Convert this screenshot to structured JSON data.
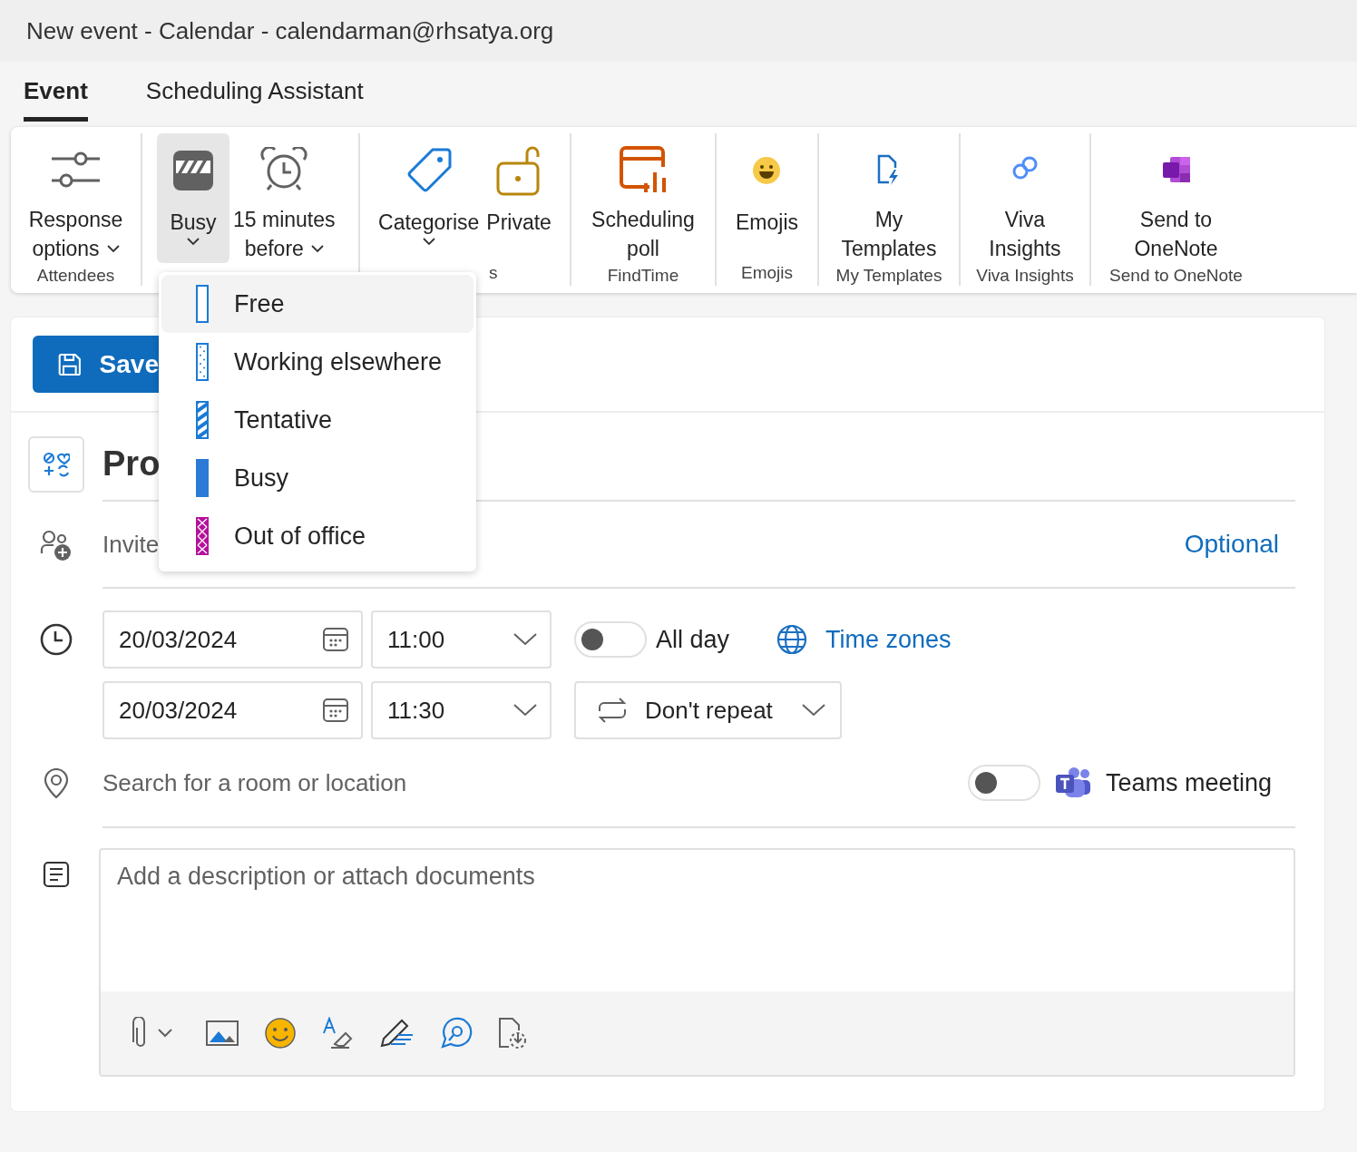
{
  "window": {
    "title": "New event - Calendar - calendarman@rhsatya.org"
  },
  "tabs": [
    {
      "label": "Event",
      "selected": true
    },
    {
      "label": "Scheduling Assistant",
      "selected": false
    }
  ],
  "ribbon": {
    "groups": [
      {
        "label": "Attendees",
        "buttons": [
          {
            "lines": [
              "Response",
              "options"
            ],
            "dropdown": true,
            "selected": false
          }
        ]
      },
      {
        "buttons": [
          {
            "lines": [
              "Busy"
            ],
            "dropdown": true,
            "selected": true
          },
          {
            "lines": [
              "15 minutes",
              "before"
            ],
            "dropdown": true,
            "selected": false
          }
        ]
      },
      {
        "label": "s",
        "buttons": [
          {
            "lines": [
              "Categorise"
            ],
            "dropdown": true,
            "selected": false
          },
          {
            "lines": [
              "Private"
            ],
            "dropdown": false,
            "selected": false
          }
        ]
      },
      {
        "label": "FindTime",
        "buttons": [
          {
            "lines": [
              "Scheduling",
              "poll"
            ],
            "dropdown": false,
            "selected": false
          }
        ]
      },
      {
        "label": "Emojis",
        "buttons": [
          {
            "lines": [
              "Emojis"
            ],
            "dropdown": false,
            "selected": false
          }
        ]
      },
      {
        "label": "My Templates",
        "buttons": [
          {
            "lines": [
              "My",
              "Templates"
            ],
            "dropdown": false,
            "selected": false
          }
        ]
      },
      {
        "label": "Viva Insights",
        "buttons": [
          {
            "lines": [
              "Viva",
              "Insights"
            ],
            "dropdown": false,
            "selected": false
          }
        ]
      },
      {
        "label": "Send to OneNote",
        "buttons": [
          {
            "lines": [
              "Send to",
              "OneNote"
            ],
            "dropdown": false,
            "selected": false
          }
        ]
      }
    ]
  },
  "busy_menu": {
    "items": [
      {
        "kind": "free",
        "label": "Free",
        "hovered": true
      },
      {
        "kind": "elsewhere",
        "label": "Working elsewhere",
        "hovered": false
      },
      {
        "kind": "tentative",
        "label": "Tentative",
        "hovered": false
      },
      {
        "kind": "busy",
        "label": "Busy",
        "hovered": false
      },
      {
        "kind": "oof",
        "label": "Out of office",
        "hovered": false
      }
    ]
  },
  "form": {
    "save_button": "Save",
    "title": {
      "value": "Pro"
    },
    "attendees": {
      "placeholder": "Invite",
      "optional_link": "Optional"
    },
    "start": {
      "date": "20/03/2024",
      "time": "11:00"
    },
    "end": {
      "date": "20/03/2024",
      "time": "11:30"
    },
    "all_day": {
      "label": "All day",
      "on": false
    },
    "time_zones": "Time zones",
    "repeat": "Don't repeat",
    "location": {
      "placeholder": "Search for a room or location"
    },
    "teams": {
      "label": "Teams meeting",
      "on": false
    },
    "description": {
      "placeholder": "Add a description or attach documents"
    }
  }
}
